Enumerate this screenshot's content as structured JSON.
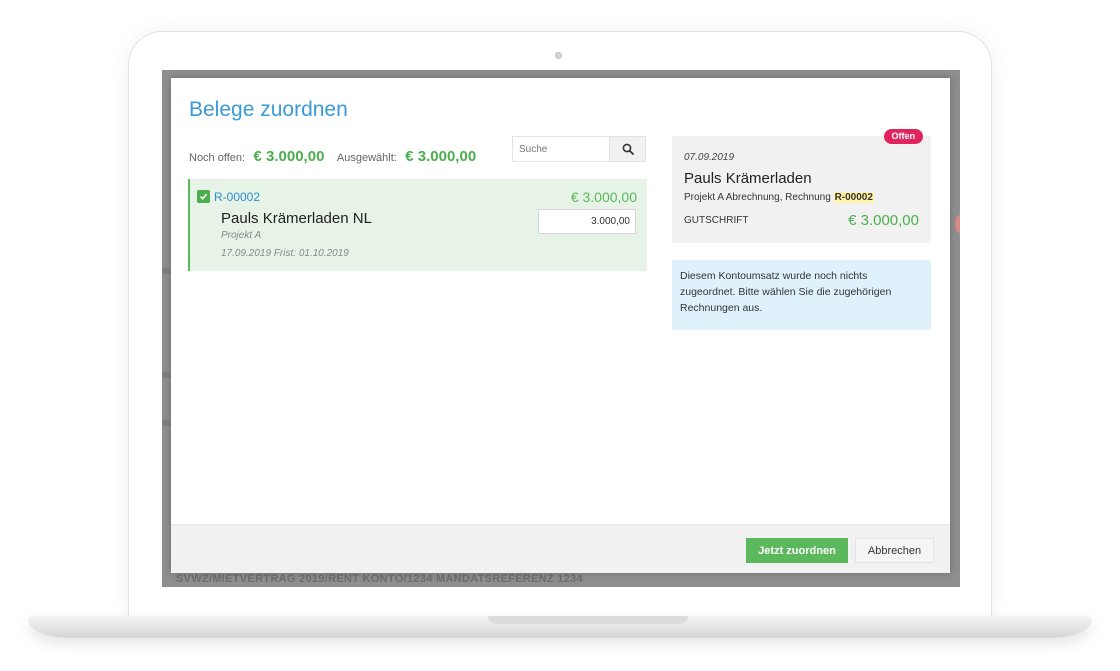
{
  "modal": {
    "title": "Belege zuordnen",
    "summary": {
      "open_label": "Noch offen:",
      "open_amount": "€ 3.000,00",
      "selected_label": "Ausgewählt:",
      "selected_amount": "€ 3.000,00"
    },
    "search": {
      "placeholder": "Suche",
      "icon": "search-icon"
    },
    "invoice": {
      "number": "R-00002",
      "amount": "€ 3.000,00",
      "client": "Pauls Krämerladen NL",
      "project": "Projekt A",
      "dates": "17.09.2019 Frist: 01.10.2019",
      "assigned_value": "3.000,00",
      "checked": true
    },
    "transaction": {
      "status": "Offen",
      "date": "07.09.2019",
      "client": "Pauls Krämerladen",
      "reference_prefix": "Projekt A Abrechnung, Rechnung",
      "reference_highlight": "R-00002",
      "type": "GUTSCHRIFT",
      "amount": "€ 3.000,00"
    },
    "info_text": "Diesem Kontoumsatz wurde noch nichts zugeordnet. Bitte wählen Sie die zugehörigen Rechnungen aus.",
    "footer": {
      "primary_label": "Jetzt zuordnen",
      "secondary_label": "Abbrechen"
    }
  },
  "background": {
    "footer_text": "SVWZ/MIETVERTRAG 2019/RENT KONTO/1234 MANDATSREFERENZ 1234"
  },
  "colors": {
    "accent_blue": "#3a9ad9",
    "success_green": "#5cb85c",
    "badge_red": "#e0245e",
    "info_bg": "#dff1fb"
  }
}
